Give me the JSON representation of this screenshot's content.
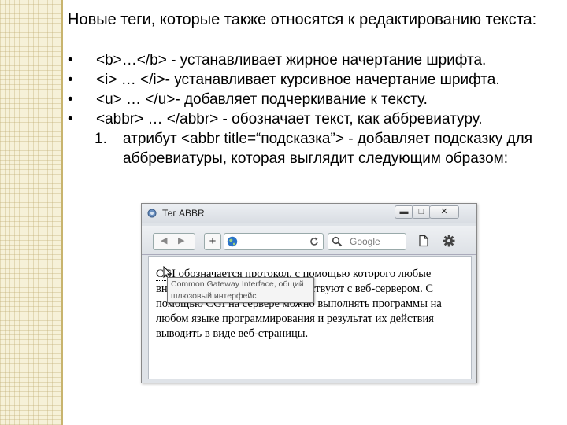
{
  "slide": {
    "title": "Новые теги, которые также относятся к редактированию текста:",
    "bullet_symbol": "•",
    "bullets": [
      "<b>…</b> - устанавливает жирное начертание шрифта.",
      "<i> … </i>- устанавливает курсивное начертание шрифта.",
      "<u> … </u>- добавляет подчеркивание к тексту.",
      "<abbr> … </abbr> - обозначает текст, как аббревиатуру."
    ],
    "numbered": {
      "number": "1.",
      "text": "атрибут <abbr title=“подсказка”> - добавляет подсказку для аббревиатуры, которая выглядит следующим образом:"
    }
  },
  "browser": {
    "window_title": "Тег ABBR",
    "window_buttons": {
      "minimize": "▬",
      "maximize": "□",
      "close": "✕"
    },
    "nav": {
      "back": "◀",
      "forward": "▶"
    },
    "new_tab": "+",
    "search_placeholder": "Google",
    "icons": [
      "page-icon",
      "globe-icon",
      "reload-icon",
      "search-icon",
      "document-icon",
      "gear-icon",
      "arrow-cursor-icon"
    ],
    "content": {
      "abbr": "CGI",
      "body": " обозначается протокол, с помощью которого любые внешние программы взаимодействуют с веб-сервером. С помощью CGI на сервере можно выполнять программы на любом языке программирования и результат их действия выводить в виде веб-страницы."
    },
    "tooltip_lines": [
      "Common Gateway Interface, общий",
      "шлюзовый интерфейс"
    ]
  },
  "colors": {
    "accent_strip": "#f6f1d8",
    "strip_line": "#c8b46e",
    "globe": "#2a73c8"
  }
}
